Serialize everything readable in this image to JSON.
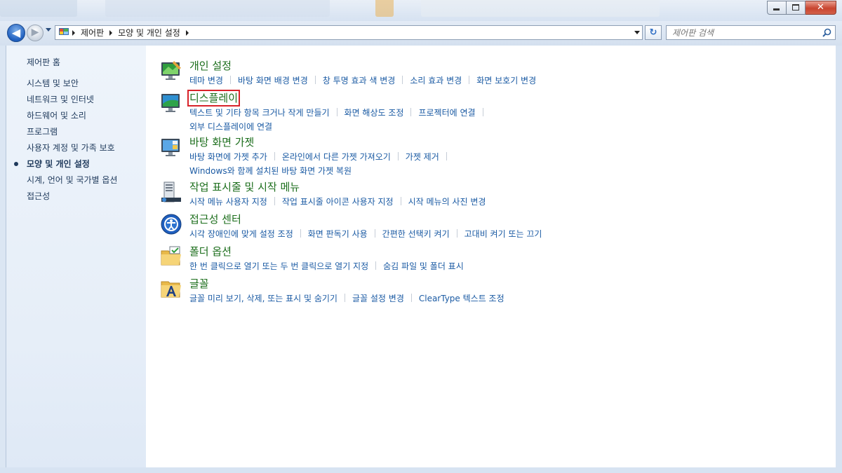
{
  "window": {
    "caption_buttons": {
      "minimize": "–",
      "maximize": "□",
      "close": "✕"
    }
  },
  "navigation": {
    "back_glyph": "◀",
    "forward_glyph": "▶",
    "breadcrumbs": [
      "제어판",
      "모양 및 개인 설정"
    ],
    "refresh_glyph": "↻",
    "search_placeholder": "제어판 검색"
  },
  "sidebar": {
    "home": "제어판 홈",
    "items": [
      {
        "label": "시스템 및 보안",
        "active": false
      },
      {
        "label": "네트워크 및 인터넷",
        "active": false
      },
      {
        "label": "하드웨어 및 소리",
        "active": false
      },
      {
        "label": "프로그램",
        "active": false
      },
      {
        "label": "사용자 계정 및 가족 보호",
        "active": false
      },
      {
        "label": "모양 및 개인 설정",
        "active": true
      },
      {
        "label": "시계, 언어 및 국가별 옵션",
        "active": false
      },
      {
        "label": "접근성",
        "active": false
      }
    ]
  },
  "categories": [
    {
      "title": "개인 설정",
      "icon": "personalization-icon",
      "rows": [
        [
          "테마 변경",
          "바탕 화면 배경 변경",
          "창 투명 효과 색 변경",
          "소리 효과 변경",
          "화면 보호기 변경"
        ]
      ]
    },
    {
      "title": "디스플레이",
      "icon": "display-icon",
      "highlighted": true,
      "rows": [
        [
          "텍스트 및 기타 항목 크거나 작게 만들기",
          "화면 해상도 조정",
          "프로젝터에 연결"
        ],
        [
          "외부 디스플레이에 연결"
        ]
      ]
    },
    {
      "title": "바탕 화면 가젯",
      "icon": "desktop-gadgets-icon",
      "rows": [
        [
          "바탕 화면에 가젯 추가",
          "온라인에서 다른 가젯 가져오기",
          "가젯 제거"
        ],
        [
          "Windows와 함께 설치된 바탕 화면 가젯 복원"
        ]
      ]
    },
    {
      "title": "작업 표시줄 및 시작 메뉴",
      "icon": "taskbar-icon",
      "rows": [
        [
          "시작 메뉴 사용자 지정",
          "작업 표시줄 아이콘 사용자 지정",
          "시작 메뉴의 사진 변경"
        ]
      ]
    },
    {
      "title": "접근성 센터",
      "icon": "ease-of-access-icon",
      "rows": [
        [
          "시각 장애인에 맞게 설정 조정",
          "화면 판독기 사용",
          "간편한 선택키 켜기",
          "고대비 켜기 또는 끄기"
        ]
      ]
    },
    {
      "title": "폴더 옵션",
      "icon": "folder-options-icon",
      "rows": [
        [
          "한 번 클릭으로 열기 또는 두 번 클릭으로 열기 지정",
          "숨김 파일 및 폴더 표시"
        ]
      ]
    },
    {
      "title": "글꼴",
      "icon": "fonts-icon",
      "rows": [
        [
          "글꼴 미리 보기, 삭제, 또는 표시 및 숨기기",
          "글꼴 설정 변경",
          "ClearType 텍스트 조정"
        ]
      ]
    }
  ],
  "colors": {
    "category_title": "#1c6e1c",
    "link": "#1a5aa3",
    "highlight_box": "#d8222a",
    "sidebar_text": "#1e395b"
  }
}
